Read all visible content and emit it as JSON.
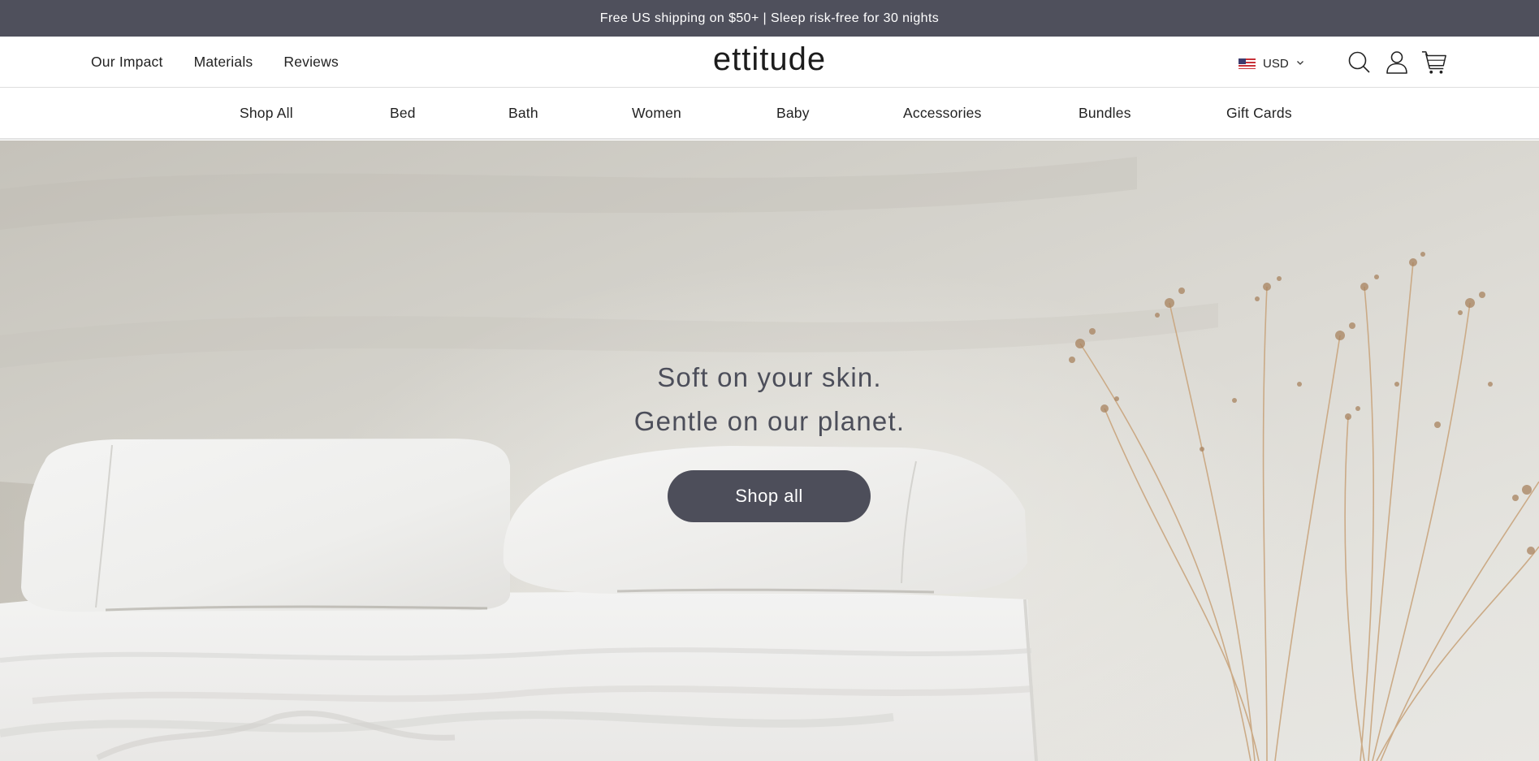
{
  "announcement": {
    "text": "Free US shipping on $50+ | Sleep risk-free for 30 nights"
  },
  "header": {
    "utility_nav": [
      {
        "label": "Our Impact"
      },
      {
        "label": "Materials"
      },
      {
        "label": "Reviews"
      }
    ],
    "logo": "ettitude",
    "currency": {
      "flag": "us-flag-icon",
      "code": "USD"
    },
    "icons": [
      "search-icon",
      "account-icon",
      "cart-icon"
    ]
  },
  "category_nav": [
    {
      "label": "Shop All"
    },
    {
      "label": "Bed"
    },
    {
      "label": "Bath"
    },
    {
      "label": "Women"
    },
    {
      "label": "Baby"
    },
    {
      "label": "Accessories"
    },
    {
      "label": "Bundles"
    },
    {
      "label": "Gift Cards"
    }
  ],
  "hero": {
    "headline_line1": "Soft on your skin.",
    "headline_line2": "Gentle on our planet.",
    "cta_label": "Shop all",
    "image_description": "White pillows and rumpled white sheets on a bed beside dried plant stems against a pale wall"
  },
  "colors": {
    "brand_dark": "#4f505c",
    "text": "#222222",
    "hero_text": "#4c4e5a",
    "background": "#ffffff"
  }
}
